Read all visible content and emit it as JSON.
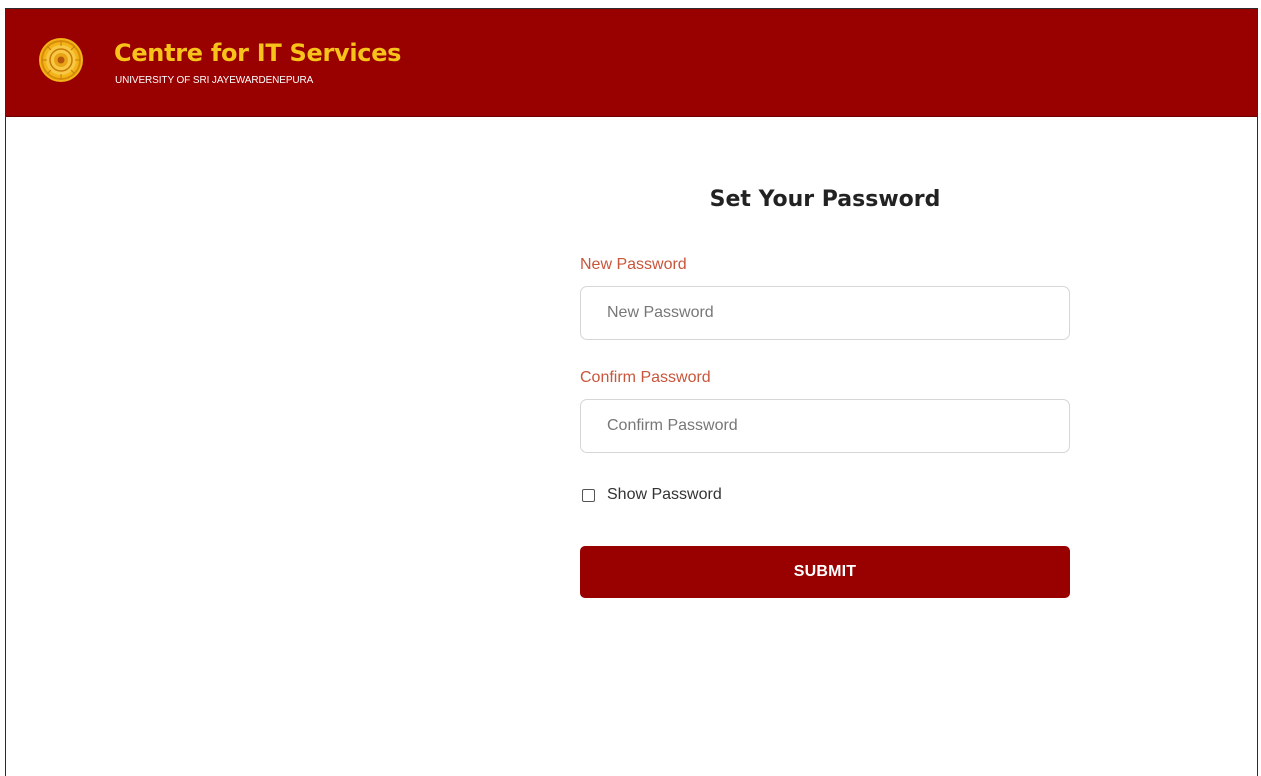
{
  "header": {
    "brand_title": "Centre for IT Services",
    "brand_subtitle": "UNIVERSITY OF SRI JAYEWARDENEPURA",
    "logo_icon": "university-emblem-icon",
    "background_color": "#990000",
    "brand_color": "#f7c21a"
  },
  "form": {
    "title": "Set Your Password",
    "new_password": {
      "label": "New Password",
      "placeholder": "New Password",
      "value": ""
    },
    "confirm_password": {
      "label": "Confirm Password",
      "placeholder": "Confirm Password",
      "value": ""
    },
    "show_password": {
      "label": "Show Password",
      "checked": false
    },
    "submit_label": "SUBMIT",
    "label_color": "#c9553a",
    "button_color": "#990000"
  }
}
